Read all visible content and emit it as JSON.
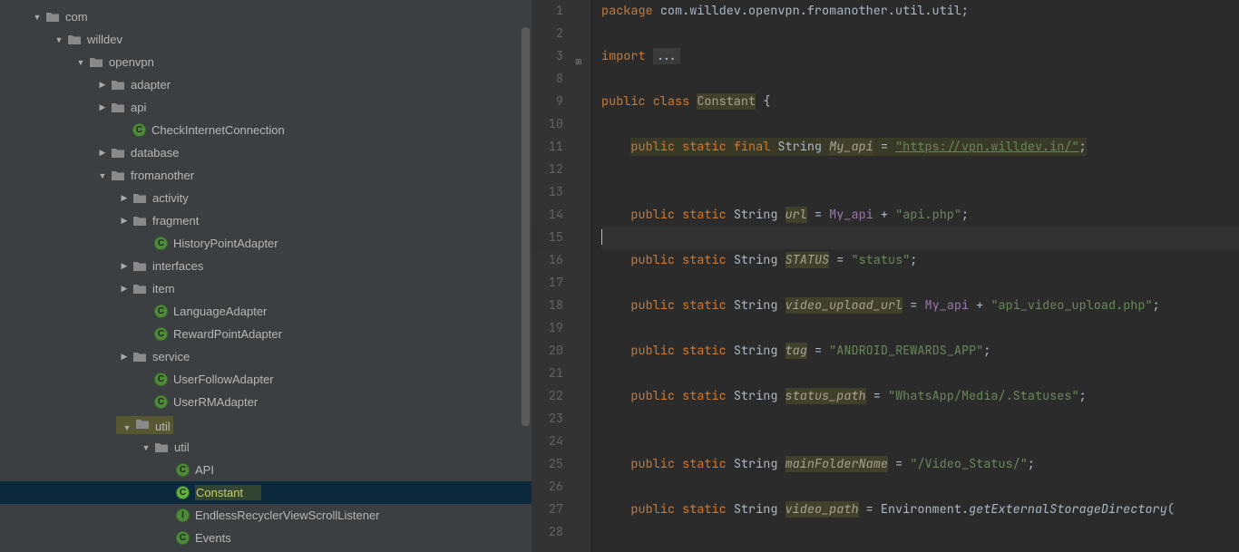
{
  "tree": [
    {
      "indent": 32,
      "chev": "down",
      "icon": "folder",
      "label": "com"
    },
    {
      "indent": 56,
      "chev": "down",
      "icon": "folder",
      "label": "willdev"
    },
    {
      "indent": 80,
      "chev": "down",
      "icon": "folder",
      "label": "openvpn"
    },
    {
      "indent": 104,
      "chev": "right",
      "icon": "folder",
      "label": "adapter"
    },
    {
      "indent": 104,
      "chev": "right",
      "icon": "folder",
      "label": "api"
    },
    {
      "indent": 128,
      "chev": "",
      "icon": "class",
      "label": "CheckInternetConnection"
    },
    {
      "indent": 104,
      "chev": "right",
      "icon": "folder",
      "label": "database"
    },
    {
      "indent": 104,
      "chev": "down",
      "icon": "folder",
      "label": "fromanother"
    },
    {
      "indent": 128,
      "chev": "right",
      "icon": "folder",
      "label": "activity"
    },
    {
      "indent": 128,
      "chev": "right",
      "icon": "folder",
      "label": "fragment"
    },
    {
      "indent": 152,
      "chev": "",
      "icon": "class",
      "label": "HistoryPointAdapter"
    },
    {
      "indent": 128,
      "chev": "right",
      "icon": "folder",
      "label": "interfaces"
    },
    {
      "indent": 128,
      "chev": "right",
      "icon": "folder",
      "label": "item"
    },
    {
      "indent": 152,
      "chev": "",
      "icon": "class",
      "label": "LanguageAdapter"
    },
    {
      "indent": 152,
      "chev": "",
      "icon": "class",
      "label": "RewardPointAdapter"
    },
    {
      "indent": 128,
      "chev": "right",
      "icon": "folder",
      "label": "service"
    },
    {
      "indent": 152,
      "chev": "",
      "icon": "class",
      "label": "UserFollowAdapter"
    },
    {
      "indent": 152,
      "chev": "",
      "icon": "class",
      "label": "UserRMAdapter"
    },
    {
      "indent": 128,
      "chev": "down",
      "icon": "folder",
      "label": "util",
      "hl": "folder"
    },
    {
      "indent": 152,
      "chev": "down",
      "icon": "folder",
      "label": "util"
    },
    {
      "indent": 176,
      "chev": "",
      "icon": "class",
      "label": "API"
    },
    {
      "indent": 176,
      "chev": "",
      "icon": "class",
      "label": "Constant",
      "selected": true,
      "hl": "file"
    },
    {
      "indent": 176,
      "chev": "",
      "icon": "iface",
      "label": "EndlessRecyclerViewScrollListener"
    },
    {
      "indent": 176,
      "chev": "",
      "icon": "class",
      "label": "Events"
    }
  ],
  "gutter": [
    "1",
    "2",
    "3",
    "8",
    "9",
    "10",
    "11",
    "12",
    "13",
    "14",
    "15",
    "16",
    "17",
    "18",
    "19",
    "20",
    "21",
    "22",
    "23",
    "24",
    "25",
    "26",
    "27",
    "28"
  ],
  "code": {
    "package": "com.willdev.openvpn.fromanother.util.util",
    "import_kw": "import",
    "import_rest": "...",
    "class_decl_pre": "public class",
    "class_name": "Constant",
    "class_open": "{",
    "l1_mods": "public static final",
    "l1_type": "String",
    "l1_name": "My_api",
    "l1_eq": " = ",
    "l1_val": "\"https://vpn.willdev.in/\"",
    "l2_mods": "public static",
    "l2_type": "String",
    "l2_name": "url",
    "l2_val": " = My_api + \"api.php\";",
    "l3_mods": "public static",
    "l3_type": "String",
    "l3_name": "STATUS",
    "l3_val": " = \"status\";",
    "l4_mods": "public static",
    "l4_type": "String",
    "l4_name": "video_upload_url",
    "l4_val": " = My_api + \"api_video_upload.php\";",
    "l5_mods": "public static",
    "l5_type": "String",
    "l5_name": "tag",
    "l5_val": " = \"ANDROID_REWARDS_APP\";",
    "l6_mods": "public static",
    "l6_type": "String",
    "l6_name": "status_path",
    "l6_val": " = \"WhatsApp/Media/.Statuses\";",
    "l7_mods": "public static",
    "l7_type": "String",
    "l7_name": "mainFolderName",
    "l7_val": " = \"/Video_Status/\";",
    "l8_mods": "public static",
    "l8_type": "String",
    "l8_name": "video_path",
    "l8_pre": " = Environment.",
    "l8_method": "getExternalStorageDirectory",
    "l8_end": "("
  }
}
